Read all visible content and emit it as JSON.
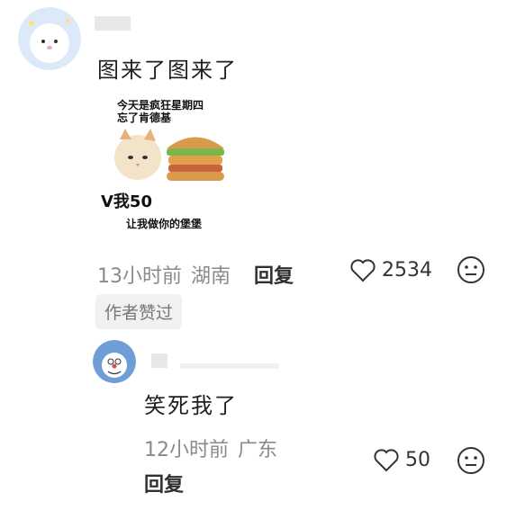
{
  "comment": {
    "text": "图来了图来了",
    "meme": {
      "top_lines": [
        "今天是疯狂星期四",
        "忘了肯德基"
      ],
      "middle": "V我50",
      "bottom": "让我做你的堡堡"
    },
    "meta": {
      "time": "13小时前",
      "location": "湖南"
    },
    "reply_label": "回复",
    "likes": "2534",
    "badge": "作者赞过",
    "icons": {
      "like": "heart-outline-icon",
      "reaction": "neutral-face-icon"
    }
  },
  "reply": {
    "text": "笑死我了",
    "meta": {
      "time": "12小时前",
      "location": "广东"
    },
    "reply_label": "回复",
    "likes": "50"
  }
}
